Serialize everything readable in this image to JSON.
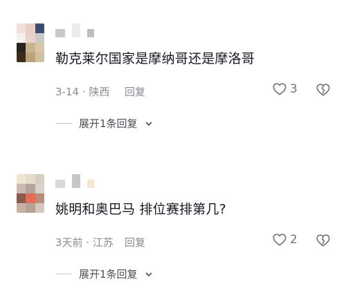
{
  "comments": [
    {
      "text": "勒克莱尔国家是摩纳哥还是摩洛哥",
      "meta": "3-14 · 陕西",
      "reply_label": "回复",
      "like_count": "3",
      "expand_label": "展开1条回复",
      "avatar_colors": [
        "#f2dfd9",
        "#e9cfc8",
        "#3c4b72",
        "#f4f1ec",
        "#e8d2cb",
        "#cbc9c6",
        "#2a2220",
        "#c9b38f",
        "#d9c6a4",
        "#3a2b1a",
        "#bda27a",
        "#cfc0a0"
      ],
      "username_colors": [
        "#c9c9c9",
        "#ececec",
        "#bdbdbd"
      ]
    },
    {
      "text": "姚明和奥巴马 排位赛排第几?",
      "meta": "3天前 · 江苏",
      "reply_label": "回复",
      "like_count": "2",
      "expand_label": "展开1条回复",
      "avatar_colors": [
        "#f1e4d2",
        "#e7dcc8",
        "#d6cfc2",
        "#c9b9b2",
        "#b3a49d",
        "#d9d2cc",
        "#8a5a4c",
        "#e66a55",
        "#b98c79",
        "#c7b3a6",
        "#b7a193",
        "#d4c7bb"
      ],
      "username_colors": [
        "#d8d8d8",
        "#c7c7c7",
        "#f3e7cf"
      ]
    }
  ],
  "colors": {
    "text_primary": "#161823",
    "text_secondary": "#8a8b91",
    "icon": "#73747b"
  },
  "icons": {
    "like": "heart-outline-icon",
    "dislike": "broken-heart-icon",
    "expand": "chevron-down-icon"
  }
}
